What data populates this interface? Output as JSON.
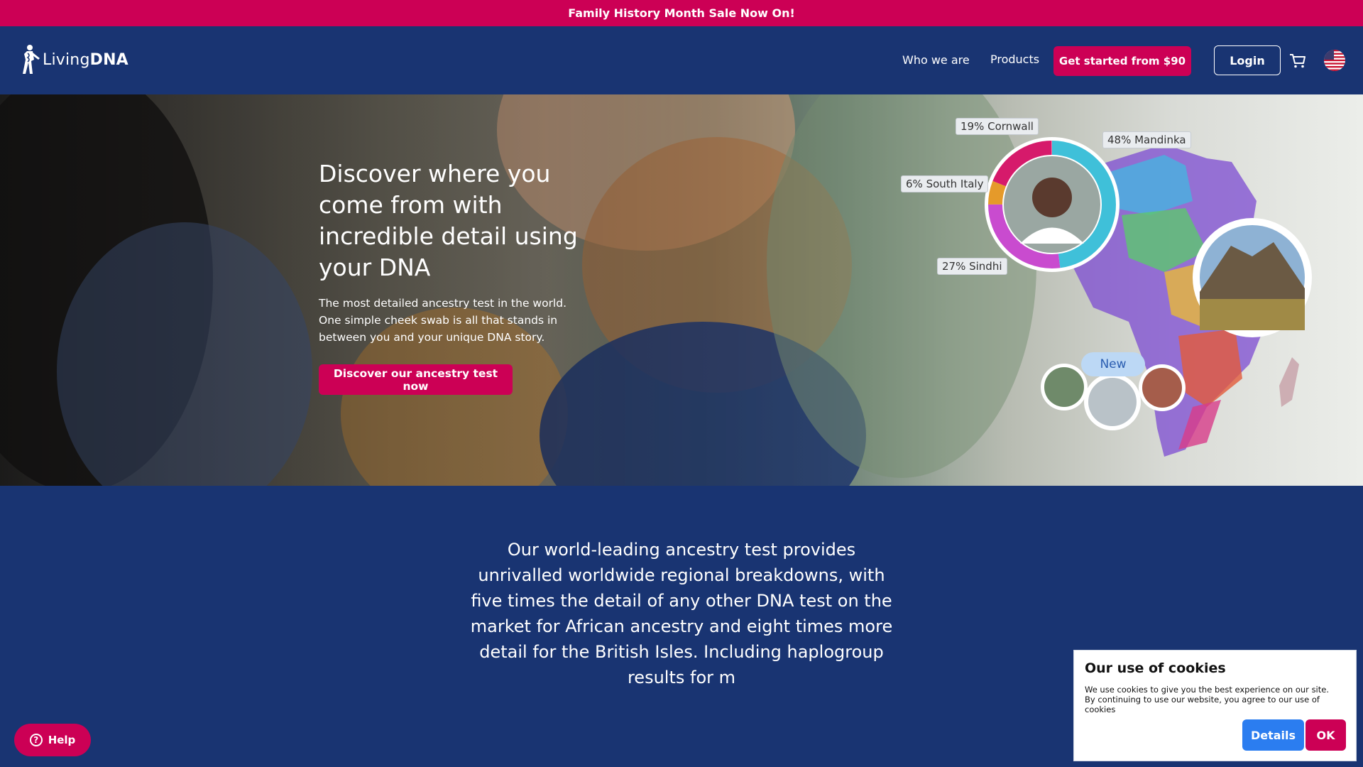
{
  "promo_bar": {
    "text": "Family History Month Sale Now On!"
  },
  "header": {
    "logo_text_light": "Living",
    "logo_text_bold": "DNA",
    "nav_who": "Who we are",
    "nav_products": "Products",
    "get_started": "Get started from $90",
    "login": "Login"
  },
  "hero": {
    "title": "Discover where you come from with incredible detail using your DNA",
    "subtitle": "The most detailed ancestry test in the world. One simple cheek swab is all that stands in between you and your unique DNA story.",
    "cta": "Discover our ancestry test now",
    "infographic": {
      "labels": [
        "19% Cornwall",
        "48% Mandinka",
        "6% South Italy",
        "27% Sindhi"
      ],
      "new_badge": "New"
    }
  },
  "main": {
    "paragraph": "Our world-leading ancestry test provides unrivalled worldwide regional breakdowns, with five times the detail of any other DNA test on the market for African ancestry and eight times more detail for the British Isles. Including haplogroup results for m"
  },
  "help": {
    "label": "Help"
  },
  "cookie": {
    "title": "Our use of cookies",
    "text": "We use cookies to give you the best experience on our site. By continuing to use our website, you agree to our use of cookies",
    "details_label": "Details",
    "ok_label": "OK"
  },
  "colors": {
    "brand_pink": "#cc0055",
    "brand_navy": "#193472",
    "details_blue": "#2b7df0"
  },
  "icons": [
    "dna-person-logo-icon",
    "cart-icon",
    "us-flag-icon",
    "question-icon"
  ]
}
